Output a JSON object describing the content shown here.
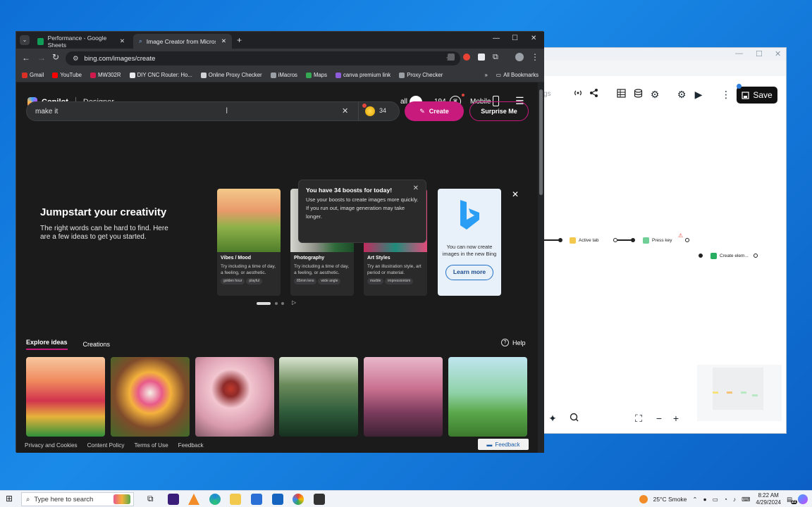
{
  "right_window": {
    "partial_text": "gs",
    "save_label": "Save",
    "nodes": [
      {
        "label": "Active tab"
      },
      {
        "label": "Press key"
      },
      {
        "label": "Create elem..."
      }
    ]
  },
  "browser": {
    "tabs": [
      {
        "label": "Performance - Google Sheets",
        "active": false
      },
      {
        "label": "Image Creator from Microsoft ...",
        "active": true
      }
    ],
    "url": "bing.com/images/create",
    "bookmarks": [
      {
        "label": "Gmail",
        "color": "#d93025"
      },
      {
        "label": "YouTube",
        "color": "#ff0000"
      },
      {
        "label": "MW302R",
        "color": "#d01a4c"
      },
      {
        "label": "DIY CNC Router: Ho...",
        "color": "#e8eaed"
      },
      {
        "label": "Online Proxy Checker",
        "color": "#cfd2d6"
      },
      {
        "label": "iMacros",
        "color": "#9aa0a6"
      },
      {
        "label": "Maps",
        "color": "#34a853"
      },
      {
        "label": "canva premium link",
        "color": "#8e5cd9"
      },
      {
        "label": "Proxy Checker",
        "color": "#9aa0a6"
      }
    ],
    "all_bookmarks": "All Bookmarks"
  },
  "bing": {
    "brand": "Copilot",
    "designer": "Designer",
    "user": "all",
    "points": "194",
    "mobile": "Mobile",
    "search_value": "make it",
    "boosts": "34",
    "create": "Create",
    "surprise": "Surprise Me",
    "tooltip_title": "You have 34 boosts for today!",
    "tooltip_body": "Use your boosts to create images more quickly. If you run out, image generation may take longer.",
    "jumpstart_title": "Jumpstart your creativity",
    "jumpstart_body": "The right words can be hard to find. Here are a few ideas to get you started.",
    "cards": [
      {
        "title": "Vibes / Mood",
        "desc": "Try including a time of day, a feeling, or aesthetic.",
        "chips": [
          "golden hour",
          "playful"
        ]
      },
      {
        "title": "Photography",
        "desc": "Try including a time of day, a feeling, or aesthetic.",
        "chips": [
          "85mm lens",
          "wide angle"
        ]
      },
      {
        "title": "Art Styles",
        "desc": "Try an illustration style, art period or material.",
        "chips": [
          "marble",
          "impressionism"
        ]
      }
    ],
    "bing_card_text": "You can now create images in the new Bing",
    "learn_more": "Learn more",
    "tab_explore": "Explore ideas",
    "tab_creations": "Creations",
    "help": "Help",
    "footer_links": [
      "Privacy and Cookies",
      "Content Policy",
      "Terms of Use",
      "Feedback"
    ],
    "feedback_button": "Feedback"
  },
  "taskbar": {
    "search_placeholder": "Type here to search",
    "weather": "25°C  Smoke",
    "time": "8:22 AM",
    "date": "4/29/2024",
    "notification_count": "21"
  }
}
